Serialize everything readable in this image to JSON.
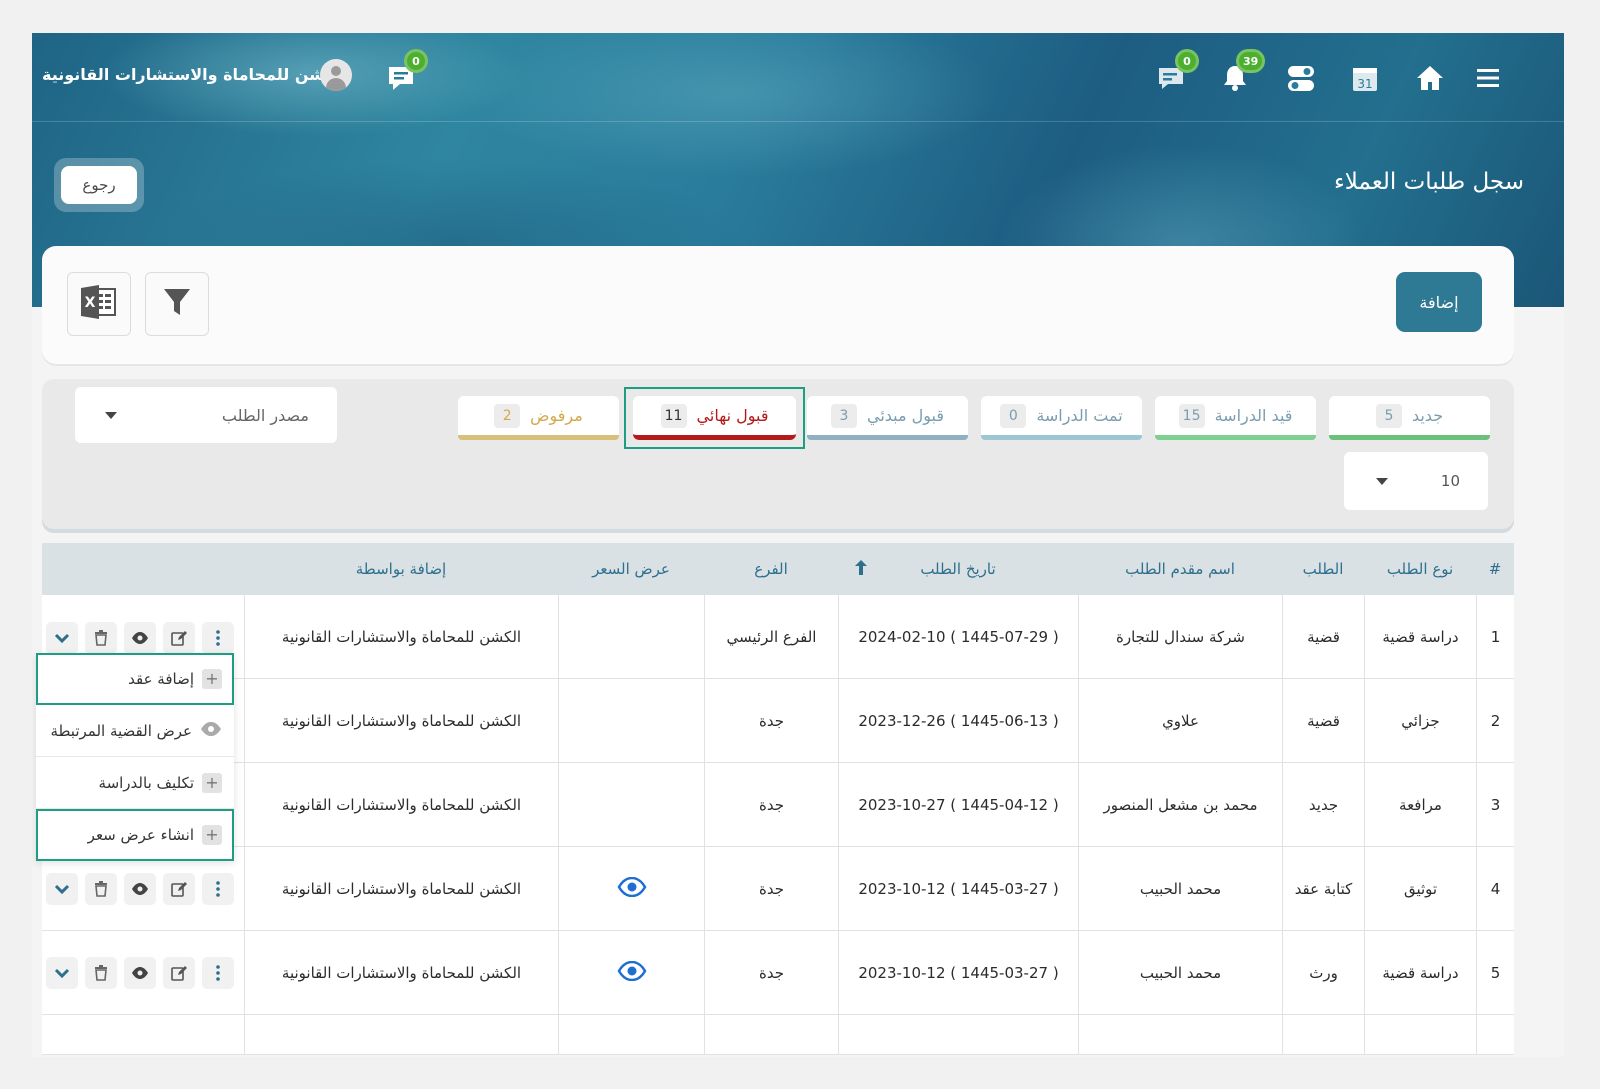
{
  "header": {
    "brand": "الكشن للمحاماة والاستشارات القانونية",
    "chat_badge": "0",
    "messages_badge": "0",
    "notifications_badge": "39",
    "calendar_day": "31"
  },
  "page": {
    "title": "سجل طلبات العملاء",
    "back_label": "رجوع",
    "add_label": "إضافة"
  },
  "status_tabs": [
    {
      "label": "جديد",
      "count": "5",
      "color": "#6cc17a",
      "text_color": "#7a9db0"
    },
    {
      "label": "قيد الدراسة",
      "count": "15",
      "color": "#7fcf8e",
      "text_color": "#7a9db0"
    },
    {
      "label": "تمت الدراسة",
      "count": "0",
      "color": "#9cc6d3",
      "text_color": "#7a9db0"
    },
    {
      "label": "قبول مبدئي",
      "count": "3",
      "color": "#8fb0c0",
      "text_color": "#7a9db0"
    },
    {
      "label": "قبول نهائي",
      "count": "11",
      "color": "#b51a1a",
      "text_color": "#b51a1a",
      "active": true
    },
    {
      "label": "مرفوض",
      "count": "2",
      "color": "#d8c07a",
      "text_color": "#d2a94c"
    }
  ],
  "filters": {
    "source_placeholder": "مصدر الطلب",
    "page_size": "10"
  },
  "table": {
    "headers": {
      "num": "#",
      "type": "نوع الطلب",
      "request": "الطلب",
      "applicant": "اسم مقدم الطلب",
      "date": "تاريخ الطلب",
      "branch": "الفرع",
      "price": "عرض السعر",
      "added_by": "إضافة بواسطة"
    },
    "rows": [
      {
        "num": "1",
        "type": "دراسة قضية",
        "request": "قضية",
        "applicant": "شركة سندال للتجارة",
        "date": "2024-02-10 ( 1445-07-29 )",
        "branch": "الفرع الرئيسي",
        "price_icon": false,
        "added_by": "الكشن للمحاماة والاستشارات القانونية"
      },
      {
        "num": "2",
        "type": "جزائي",
        "request": "قضية",
        "applicant": "علاوي",
        "date": "2023-12-26 ( 1445-06-13 )",
        "branch": "جدة",
        "price_icon": false,
        "added_by": "الكشن للمحاماة والاستشارات القانونية"
      },
      {
        "num": "3",
        "type": "مرافعة",
        "request": "جديد",
        "applicant": "محمد بن مشعل المنصور",
        "date": "2023-10-27 ( 1445-04-12 )",
        "branch": "جدة",
        "price_icon": false,
        "added_by": "الكشن للمحاماة والاستشارات القانونية"
      },
      {
        "num": "4",
        "type": "توثيق",
        "request": "كتابة عقد",
        "applicant": "محمد الحبيب",
        "date": "2023-10-12 ( 1445-03-27 )",
        "branch": "جدة",
        "price_icon": true,
        "added_by": "الكشن للمحاماة والاستشارات القانونية"
      },
      {
        "num": "5",
        "type": "دراسة قضية",
        "request": "ورث",
        "applicant": "محمد الحبيب",
        "date": "2023-10-12 ( 1445-03-27 )",
        "branch": "جدة",
        "price_icon": true,
        "added_by": "الكشن للمحاماة والاستشارات القانونية"
      }
    ]
  },
  "context_menu": {
    "items": [
      {
        "label": "إضافة عقد",
        "icon": "plus-icon",
        "highlighted": true
      },
      {
        "label": "عرض القضية المرتبطة",
        "icon": "eye-icon",
        "highlighted": false
      },
      {
        "label": "تكليف بالدراسة",
        "icon": "plus-icon",
        "highlighted": false
      },
      {
        "label": "انشاء عرض سعر",
        "icon": "plus-icon",
        "highlighted": true
      }
    ]
  },
  "colors": {
    "accent": "#2e7a94",
    "header_text": "#2e6f8e",
    "highlight_outline": "#1f9d84",
    "price_eye": "#1e6fd1"
  }
}
